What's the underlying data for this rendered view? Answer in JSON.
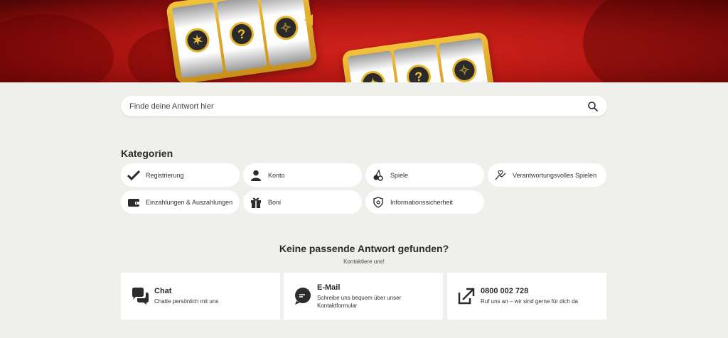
{
  "search": {
    "placeholder": "Finde deine Antwort hier"
  },
  "categories_heading": "Kategorien",
  "categories": [
    {
      "label": "Registrierung",
      "icon": "checkmark-icon"
    },
    {
      "label": "Konto",
      "icon": "user-icon"
    },
    {
      "label": "Spiele",
      "icon": "cherries-icon"
    },
    {
      "label": "Verantwortungsvolles Spielen",
      "icon": "hand-heart-icon"
    },
    {
      "label": "Einzahlungen & Auszahlungen",
      "icon": "wallet-icon"
    },
    {
      "label": "Boni",
      "icon": "gift-icon"
    },
    {
      "label": "Informationssicherheit",
      "icon": "shield-icon"
    }
  ],
  "no_match": {
    "heading": "Keine passende Antwort gefunden?",
    "subheading": "Kontaktiere uns!"
  },
  "contact": [
    {
      "title": "Chat",
      "text": "Chatte persönlich mit uns",
      "icon": "chat-icon"
    },
    {
      "title": "E-Mail",
      "text": "Schreibe uns bequem über unser Kontaktformular",
      "icon": "email-bubble-icon"
    },
    {
      "title": "0800 002 728",
      "text": "Ruf uns an – wir sind gerne für dich da",
      "icon": "phone-callout-icon"
    }
  ],
  "colors": {
    "hero_red": "#b31612",
    "gold": "#e5b52f",
    "background": "#efefeb"
  }
}
